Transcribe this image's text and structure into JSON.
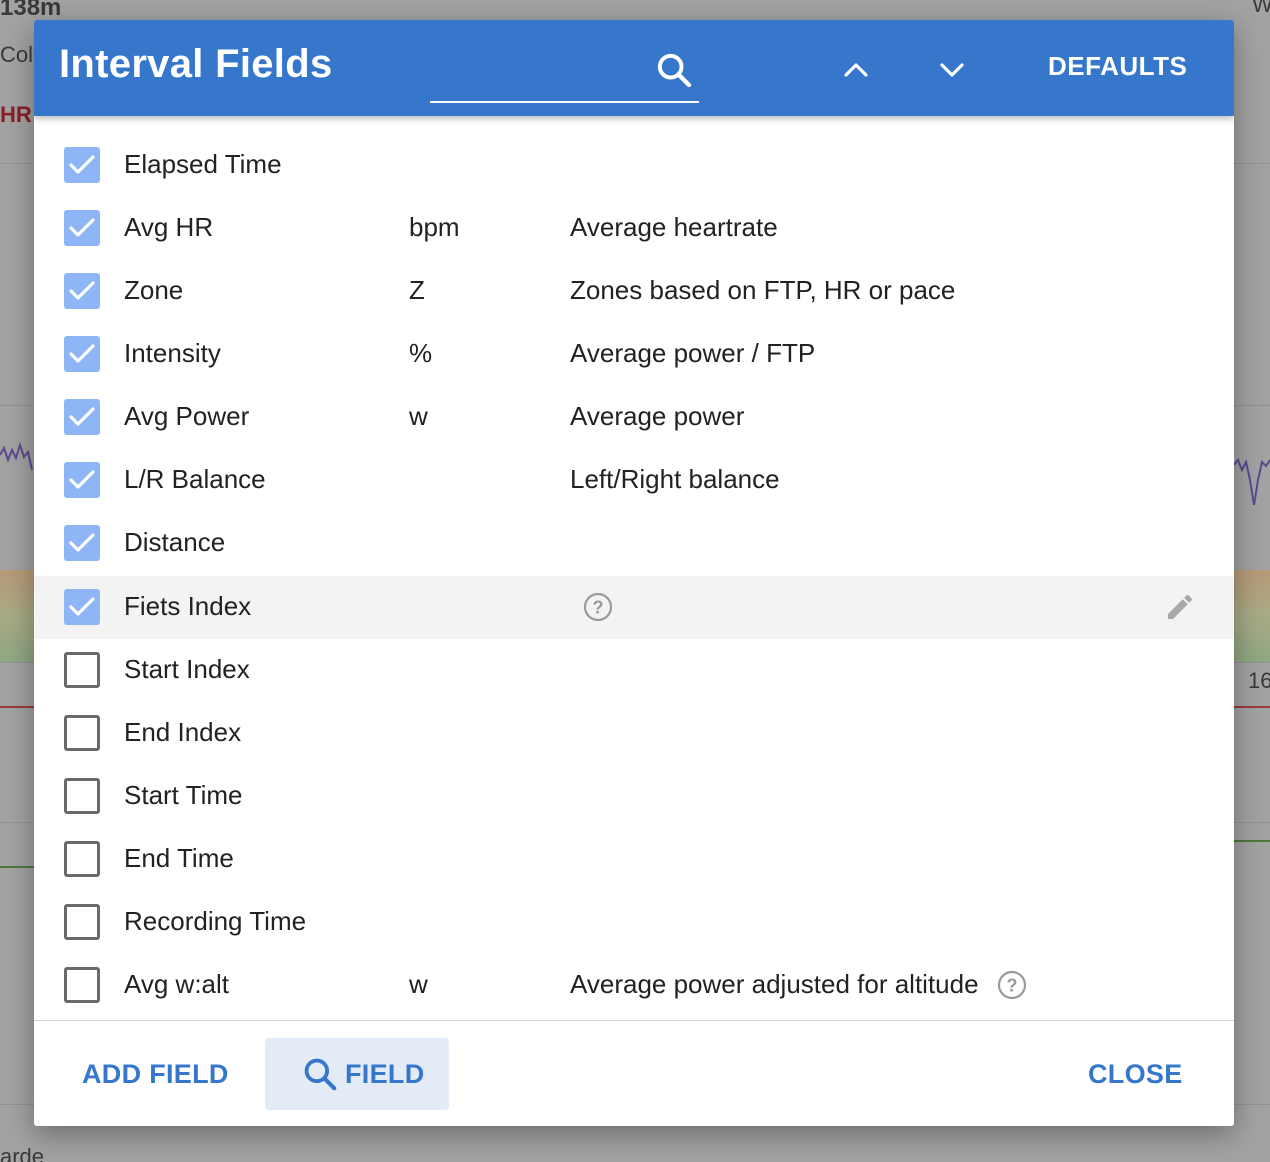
{
  "background": {
    "top_left_text": "138m",
    "col_text": "Col",
    "hr_text": "HR",
    "right_number": "16",
    "bottom_text": "arde",
    "right_letter": "W"
  },
  "dialog": {
    "title": "Interval Fields",
    "search": {
      "value": "",
      "placeholder": ""
    },
    "defaults_label": "DEFAULTS",
    "accent_color": "#3677cc"
  },
  "fields": [
    {
      "name": "Elapsed Time",
      "unit": "",
      "description": "",
      "checked": true
    },
    {
      "name": "Avg HR",
      "unit": "bpm",
      "description": "Average heartrate",
      "checked": true
    },
    {
      "name": "Zone",
      "unit": "Z",
      "description": "Zones based on FTP, HR or pace",
      "checked": true
    },
    {
      "name": "Intensity",
      "unit": "%",
      "description": "Average power / FTP",
      "checked": true
    },
    {
      "name": "Avg Power",
      "unit": "w",
      "description": "Average power",
      "checked": true
    },
    {
      "name": "L/R Balance",
      "unit": "",
      "description": "Left/Right balance",
      "checked": true
    },
    {
      "name": "Distance",
      "unit": "",
      "description": "",
      "checked": true
    },
    {
      "name": "Fiets Index",
      "unit": "",
      "description": "",
      "checked": true,
      "highlighted": true,
      "help": true,
      "editable": true
    },
    {
      "name": "Start Index",
      "unit": "",
      "description": "",
      "checked": false
    },
    {
      "name": "End Index",
      "unit": "",
      "description": "",
      "checked": false
    },
    {
      "name": "Start Time",
      "unit": "",
      "description": "",
      "checked": false
    },
    {
      "name": "End Time",
      "unit": "",
      "description": "",
      "checked": false
    },
    {
      "name": "Recording Time",
      "unit": "",
      "description": "",
      "checked": false
    },
    {
      "name": "Avg w:alt",
      "unit": "w",
      "description": "Average power adjusted for altitude",
      "checked": false,
      "help": true
    }
  ],
  "footer": {
    "add_field_label": "ADD FIELD",
    "field_label": "FIELD",
    "close_label": "CLOSE"
  }
}
